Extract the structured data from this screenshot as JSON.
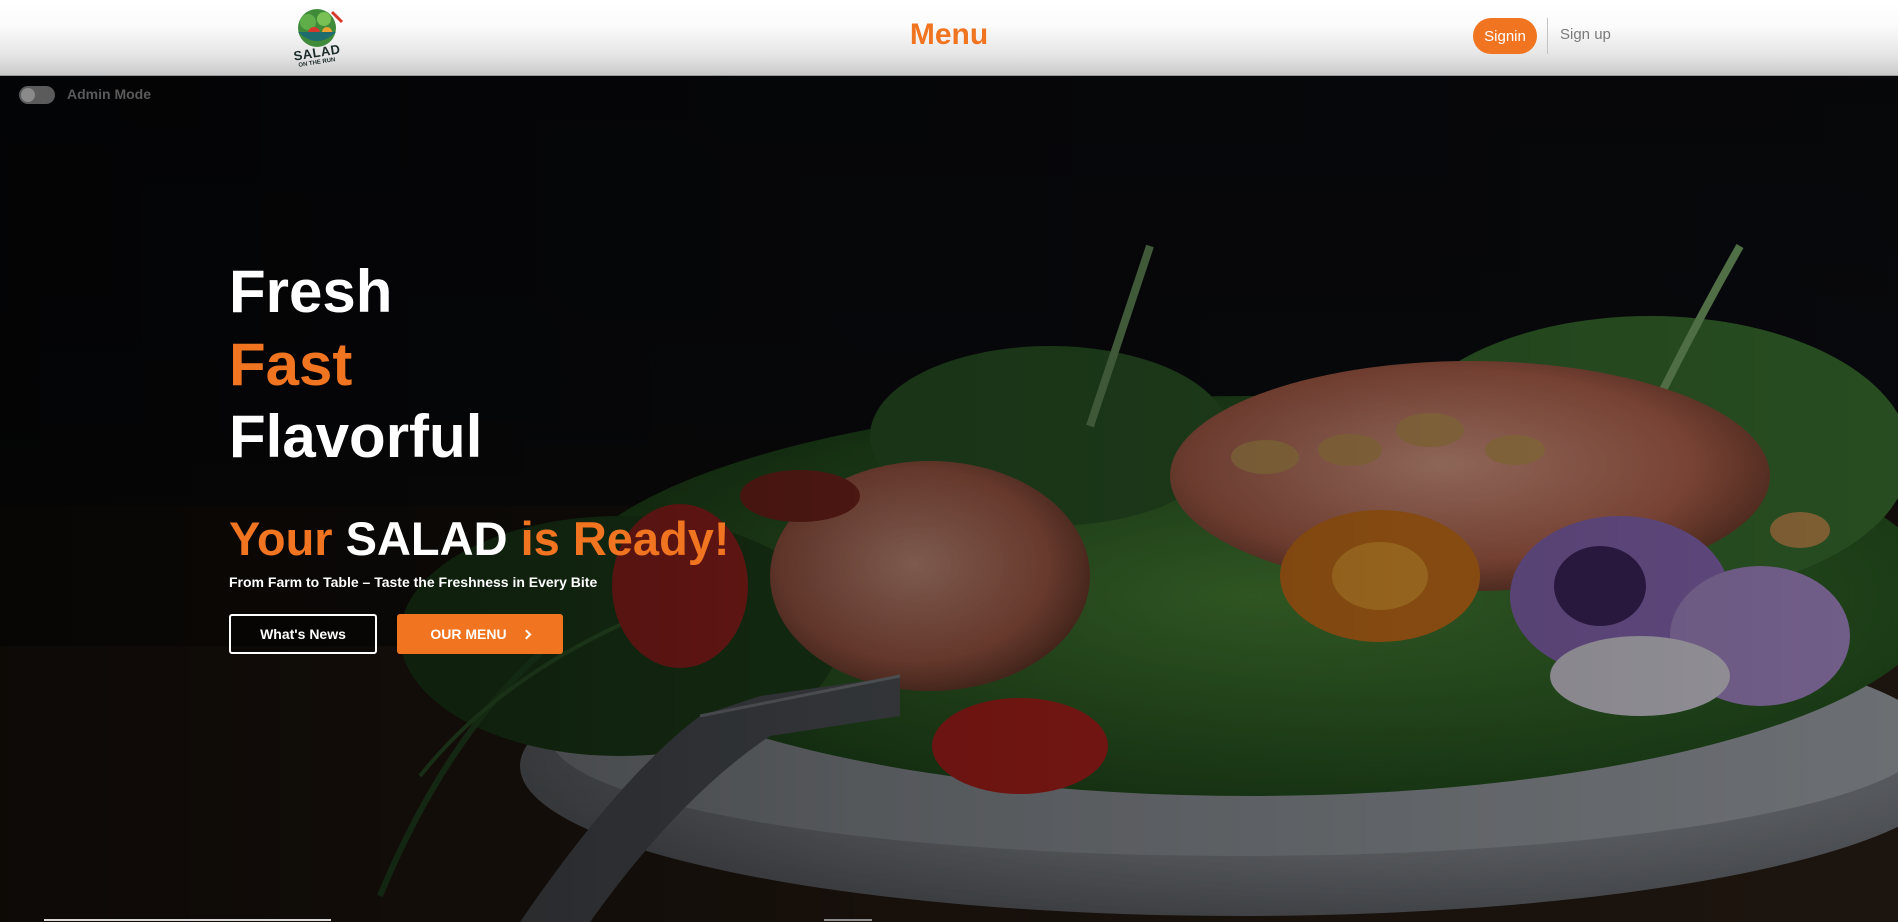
{
  "header": {
    "logo": {
      "icon": "salad-bowl-logo-icon",
      "text_main": "SALAD",
      "text_sub": "ON THE RUN"
    },
    "nav_title": "Menu",
    "signin_label": "Signin",
    "signup_label": "Sign up"
  },
  "admin": {
    "label": "Admin Mode",
    "enabled": false
  },
  "hero": {
    "headline": [
      "Fresh",
      "Fast",
      "Flavorful"
    ],
    "ready": {
      "part1": "Your",
      "part2": "SALAD",
      "part3": "is Ready!"
    },
    "tagline": "From Farm to Table – Taste the Freshness in Every Bite",
    "news_button": "What's News",
    "menu_button": "OUR MENU",
    "background_image": "salmon-salad-plate-photo"
  },
  "colors": {
    "accent": "#f17420",
    "header_top": "#ffffff",
    "header_bottom": "#c9c9c9",
    "hero_background": "#0c0d10",
    "text_light": "#ffffff"
  }
}
